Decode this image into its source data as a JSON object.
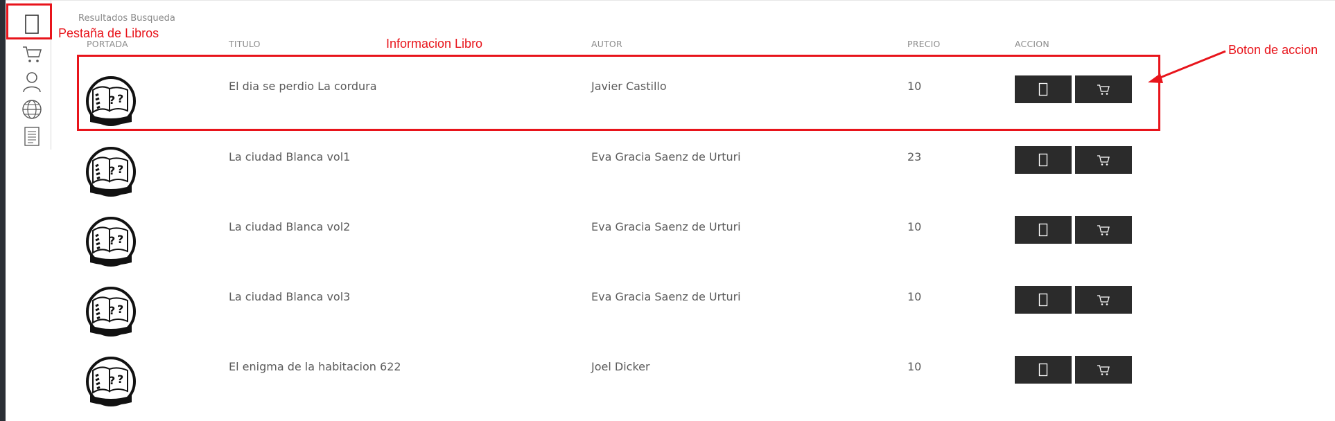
{
  "page": {
    "title": "Resultados Busqueda"
  },
  "sidebar": {
    "items": [
      {
        "icon": "book-icon"
      },
      {
        "icon": "cart-icon"
      },
      {
        "icon": "user-icon"
      },
      {
        "icon": "globe-icon"
      },
      {
        "icon": "document-icon"
      }
    ]
  },
  "table": {
    "columns": [
      "PORTADA",
      "TITULO",
      "AUTOR",
      "PRECIO",
      "ACCION"
    ],
    "rows": [
      {
        "titulo": "El dia se perdio La cordura",
        "autor": "Javier Castillo",
        "precio": "10"
      },
      {
        "titulo": "La ciudad Blanca vol1",
        "autor": "Eva Gracia Saenz de Urturi",
        "precio": "23"
      },
      {
        "titulo": "La ciudad Blanca vol2",
        "autor": "Eva Gracia Saenz de Urturi",
        "precio": "10"
      },
      {
        "titulo": "La ciudad Blanca vol3",
        "autor": "Eva Gracia Saenz de Urturi",
        "precio": "10"
      },
      {
        "titulo": "El enigma de la habitacion 622",
        "autor": "Joel Dicker",
        "precio": "10"
      }
    ],
    "actions": {
      "book_icon": "book-icon",
      "cart_icon": "cart-icon"
    }
  },
  "annotations": {
    "tab_label": "Pestaña de Libros",
    "info_label": "Informacion Libro",
    "action_label": "Boton de accion",
    "color": "#e8141b"
  },
  "colors": {
    "button_bg": "#2b2b2b",
    "sidebar_edge": "#2b2f36"
  }
}
